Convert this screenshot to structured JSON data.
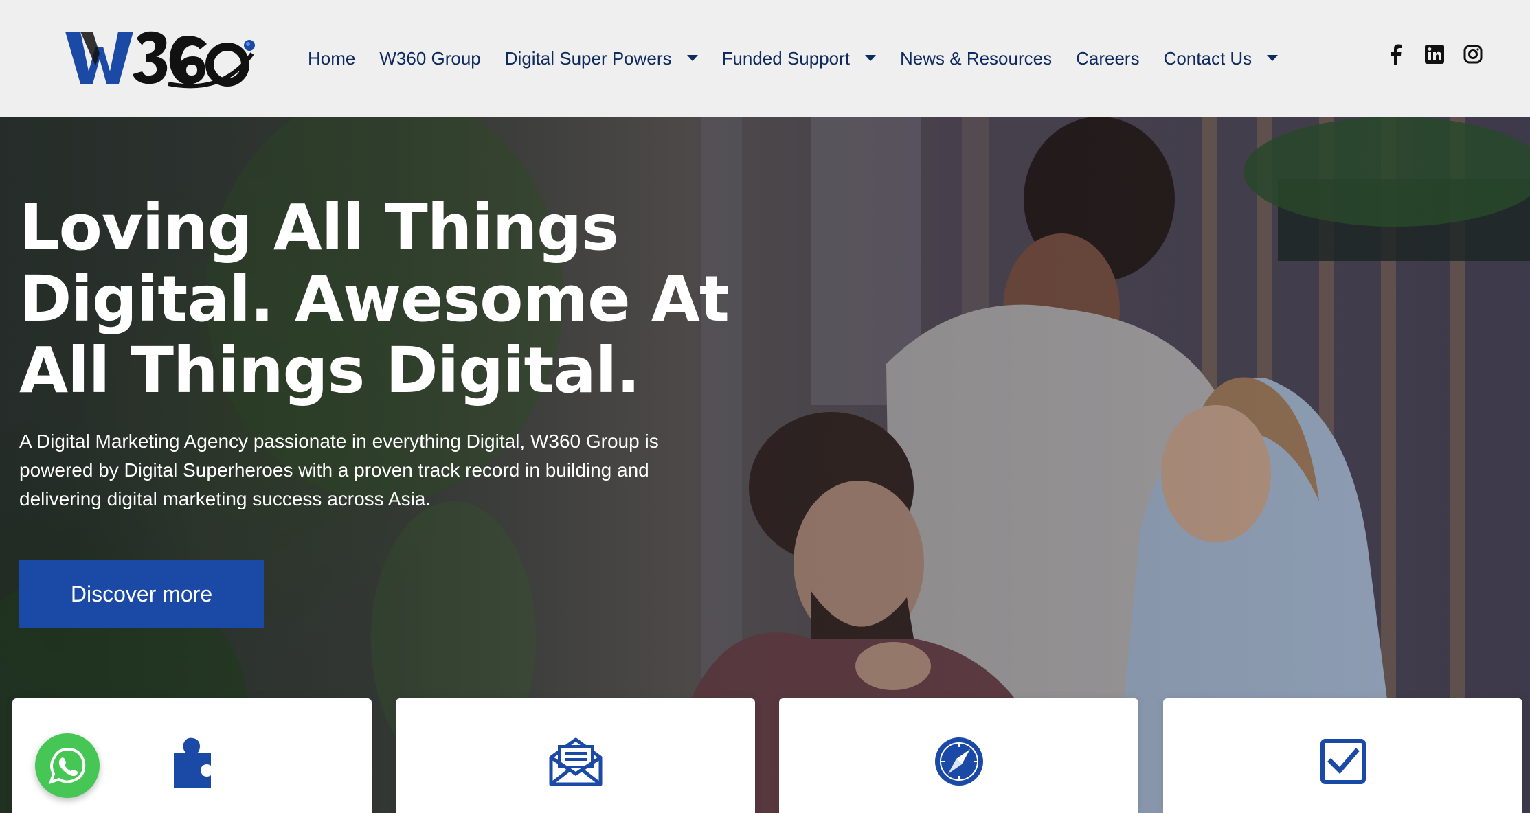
{
  "header": {
    "logo_text": "W360",
    "nav": [
      {
        "label": "Home",
        "has_dropdown": false
      },
      {
        "label": "W360 Group",
        "has_dropdown": false
      },
      {
        "label": "Digital Super Powers",
        "has_dropdown": true
      },
      {
        "label": "Funded Support",
        "has_dropdown": true
      },
      {
        "label": "News & Resources",
        "has_dropdown": false
      },
      {
        "label": "Careers",
        "has_dropdown": false
      },
      {
        "label": "Contact Us",
        "has_dropdown": true
      }
    ],
    "socials": [
      "facebook-icon",
      "linkedin-icon",
      "instagram-icon"
    ]
  },
  "hero": {
    "title_line1": "Loving All Things",
    "title_line2": "Digital. Awesome At",
    "title_line3": "All Things Digital.",
    "subtitle": "A Digital Marketing Agency passionate in everything Digital, W360 Group is powered by Digital Superheroes with a proven track record in building and delivering digital marketing success across Asia.",
    "cta_label": "Discover more"
  },
  "cards": [
    {
      "icon": "puzzle-icon"
    },
    {
      "icon": "envelope-open-icon"
    },
    {
      "icon": "compass-icon"
    },
    {
      "icon": "checkbox-icon"
    }
  ],
  "colors": {
    "brand_blue": "#1b4aa6",
    "nav_text": "#0f2a5e",
    "header_bg": "#efefef",
    "whatsapp_green": "#45c655"
  }
}
